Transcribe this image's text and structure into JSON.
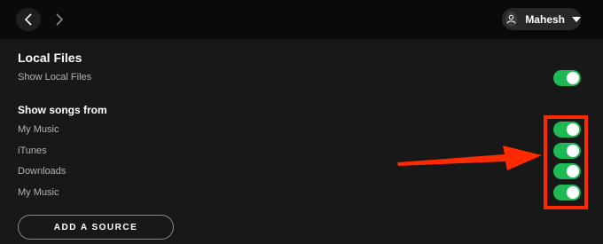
{
  "header": {
    "back_icon": "chevron-left-icon",
    "forward_icon": "chevron-right-icon",
    "user": {
      "name": "Mahesh",
      "avatar_icon": "user-icon",
      "menu_icon": "caret-down-icon"
    }
  },
  "local_files": {
    "title": "Local Files",
    "show_local_files": {
      "label": "Show Local Files",
      "enabled": true
    }
  },
  "sources": {
    "title": "Show songs from",
    "items": [
      {
        "label": "My Music",
        "enabled": true
      },
      {
        "label": "iTunes",
        "enabled": true
      },
      {
        "label": "Downloads",
        "enabled": true
      },
      {
        "label": "My Music",
        "enabled": true
      }
    ],
    "add_button_label": "ADD A SOURCE"
  },
  "colors": {
    "toggle_on": "#1db954",
    "annotation": "#ff2a00",
    "background": "#181818",
    "topbar": "#0a0a0a"
  }
}
